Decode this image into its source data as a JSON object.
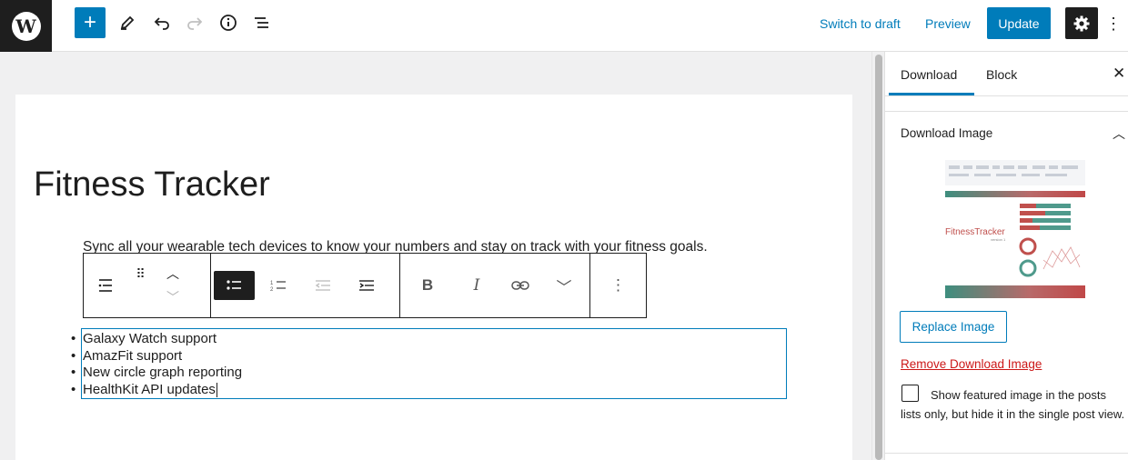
{
  "topbar": {
    "logo": "wordpress-logo",
    "switch_to_draft": "Switch to draft",
    "preview": "Preview",
    "update": "Update"
  },
  "post": {
    "title": "Fitness Tracker",
    "paragraph": "Sync all your wearable tech devices to know your numbers and stay on track with your fitness goals.",
    "list_items": [
      "Galaxy Watch support",
      "AmazFit support",
      "New circle graph reporting",
      "HealthKit API updates"
    ]
  },
  "sidebar": {
    "tabs": [
      "Download",
      "Block"
    ],
    "active_tab": "Download",
    "panel_title": "Download Image",
    "image_caption": "FitnessTracker",
    "image_subcaption": "version 1",
    "replace_label": "Replace Image",
    "remove_label": "Remove Download Image",
    "checkbox_label": "Show featured image in the posts lists only, but hide it in the single post view."
  },
  "colors": {
    "accent": "#007cba",
    "dark": "#1e1e1e",
    "danger": "#cc1818"
  }
}
